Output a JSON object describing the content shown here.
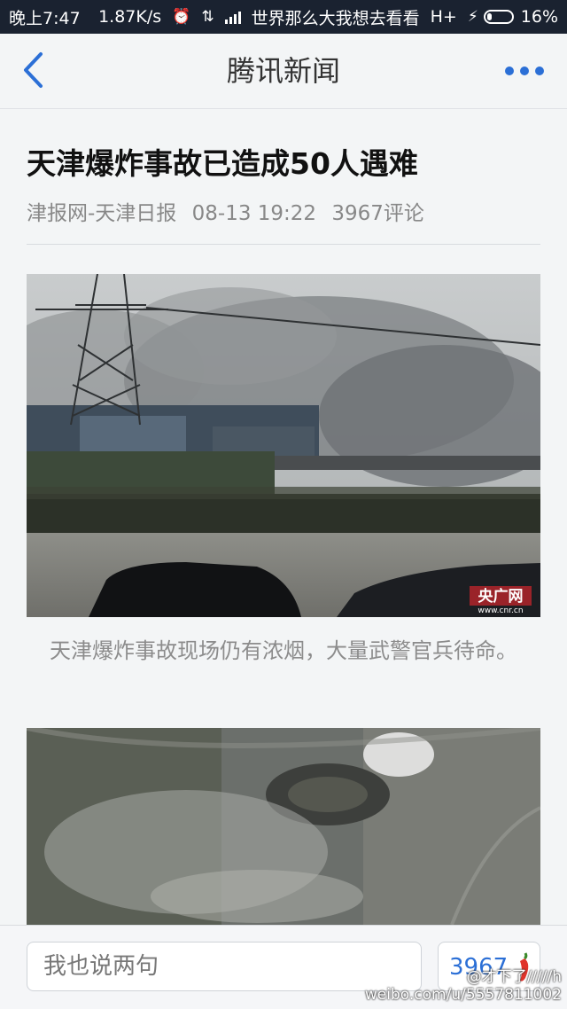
{
  "status_bar": {
    "time": "晚上7:47",
    "network_speed": "1.87K/s",
    "carrier": "世界那么大我想去看看",
    "network_type": "H+",
    "battery": "16%",
    "icons": [
      "alarm-icon",
      "vibrate-icon",
      "signal-icon",
      "charging-icon",
      "battery-icon"
    ]
  },
  "nav": {
    "title": "腾讯新闻",
    "back_icon": "chevron-left-icon",
    "more_icon": "more-dots-icon",
    "accent_color": "#2b6fd6"
  },
  "article": {
    "title": "天津爆炸事故已造成50人遇难",
    "source": "津报网-天津日报",
    "datetime": "08-13 19:22",
    "comments": "3967评论",
    "photos": [
      {
        "caption": "天津爆炸事故现场仍有浓烟，大量武警官兵待命。",
        "logo": "央广网",
        "logo_url": "www.cnr.cn"
      },
      {
        "caption": ""
      }
    ]
  },
  "bottom_bar": {
    "comment_placeholder": "我也说两句",
    "comment_count": "3967",
    "count_icon": "chili-pepper-icon"
  },
  "watermark": {
    "handle": "@才下了/////h",
    "url": "weibo.com/u/5557811002"
  }
}
